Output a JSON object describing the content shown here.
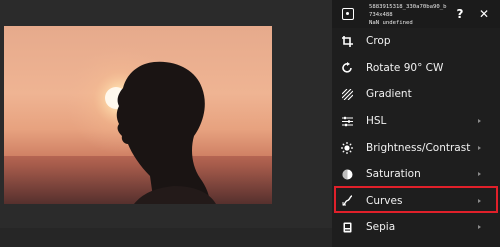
{
  "header": {
    "file_name": "5883915318_330a70ba90_b...",
    "dimensions": "734x488",
    "meta": "NaN undefined",
    "icon": "image-icon",
    "help_label": "?",
    "close_label": "✕"
  },
  "menu": {
    "items": [
      {
        "label": "Crop",
        "icon": "crop-icon",
        "has_submenu": false
      },
      {
        "label": "Rotate 90° CW",
        "icon": "rotate-icon",
        "has_submenu": false
      },
      {
        "label": "Gradient",
        "icon": "gradient-icon",
        "has_submenu": false
      },
      {
        "label": "HSL",
        "icon": "hsl-icon",
        "has_submenu": true
      },
      {
        "label": "Brightness/Contrast",
        "icon": "brightness-icon",
        "has_submenu": true
      },
      {
        "label": "Saturation",
        "icon": "saturation-icon",
        "has_submenu": true
      },
      {
        "label": "Curves",
        "icon": "curves-icon",
        "has_submenu": true,
        "highlighted": true
      },
      {
        "label": "Sepia",
        "icon": "sepia-icon",
        "has_submenu": true
      }
    ]
  },
  "colors": {
    "panel_bg": "#1e1e1e",
    "canvas_bg": "#2b2b2b",
    "highlight": "#e0202a",
    "text": "#f2f2f2"
  }
}
